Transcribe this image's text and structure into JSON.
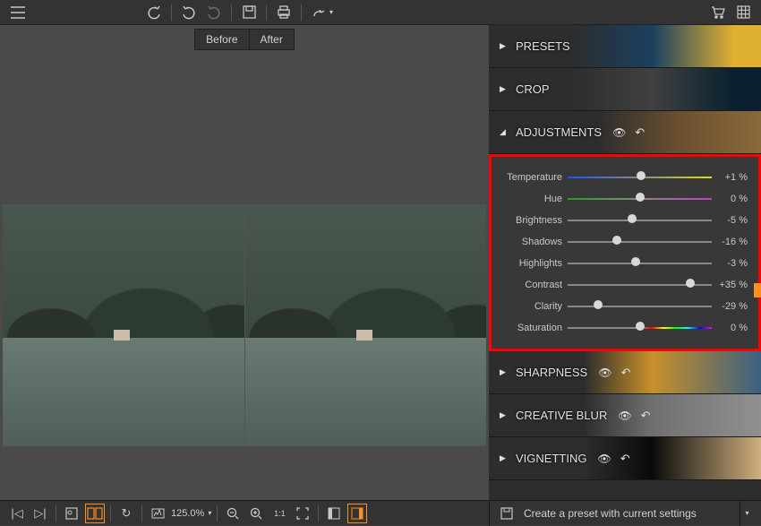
{
  "tabs": {
    "before": "Before",
    "after": "After"
  },
  "zoom": "125.0%",
  "panels": {
    "presets": "PRESETS",
    "crop": "CROP",
    "adjustments": "ADJUSTMENTS",
    "sharpness": "SHARPNESS",
    "blur": "CREATIVE BLUR",
    "vignetting": "VIGNETTING"
  },
  "adjust": [
    {
      "label": "Temperature",
      "value": "+1 %",
      "pos": 51,
      "track": "temp"
    },
    {
      "label": "Hue",
      "value": "0 %",
      "pos": 50,
      "track": "hue"
    },
    {
      "label": "Brightness",
      "value": "-5 %",
      "pos": 45,
      "track": ""
    },
    {
      "label": "Shadows",
      "value": "-16 %",
      "pos": 34,
      "track": ""
    },
    {
      "label": "Highlights",
      "value": "-3 %",
      "pos": 47,
      "track": ""
    },
    {
      "label": "Contrast",
      "value": "+35 %",
      "pos": 85,
      "track": ""
    },
    {
      "label": "Clarity",
      "value": "-29 %",
      "pos": 21,
      "track": ""
    },
    {
      "label": "Saturation",
      "value": "0 %",
      "pos": 50,
      "track": "sat"
    }
  ],
  "footer": {
    "create_preset": "Create a preset with current settings"
  }
}
